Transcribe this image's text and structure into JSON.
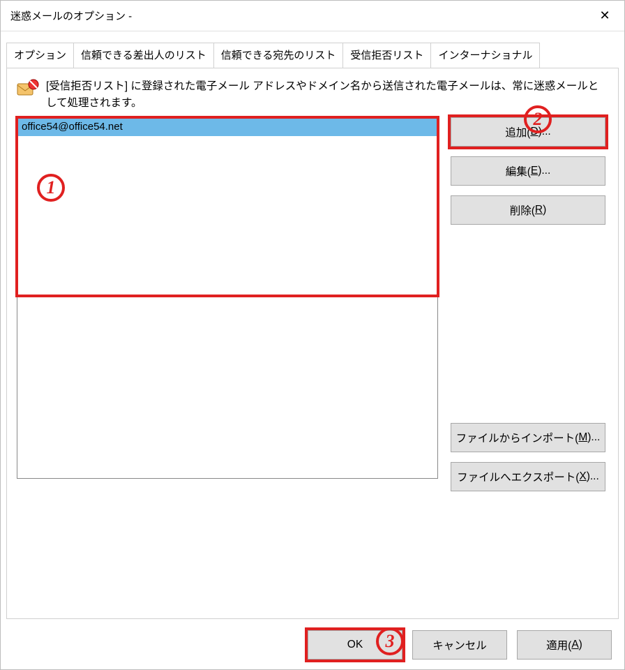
{
  "window": {
    "title": "迷惑メールのオプション - "
  },
  "tabs": {
    "options": "オプション",
    "safe_senders": "信頼できる差出人のリスト",
    "safe_recipients": "信頼できる宛先のリスト",
    "blocked_senders": "受信拒否リスト",
    "international": "インターナショナル"
  },
  "description": "[受信拒否リスト] に登録された電子メール アドレスやドメイン名から送信された電子メールは、常に迷惑メールとして処理されます。",
  "list": {
    "items": [
      "office54@office54.net"
    ],
    "selected_index": 0
  },
  "buttons": {
    "add_prefix": "追加(",
    "add_hot": "D",
    "add_suffix": ")...",
    "edit_prefix": "編集(",
    "edit_hot": "E",
    "edit_suffix": ")...",
    "remove_prefix": "削除(",
    "remove_hot": "R",
    "remove_suffix": ")",
    "import_prefix": "ファイルからインポート(",
    "import_hot": "M",
    "import_suffix": ")...",
    "export_prefix": "ファイルへエクスポート(",
    "export_hot": "X",
    "export_suffix": ")...",
    "ok": "OK",
    "cancel": "キャンセル",
    "apply_prefix": "適用(",
    "apply_hot": "A",
    "apply_suffix": ")"
  },
  "annotations": {
    "n1": "1",
    "n2": "2",
    "n3": "3"
  }
}
